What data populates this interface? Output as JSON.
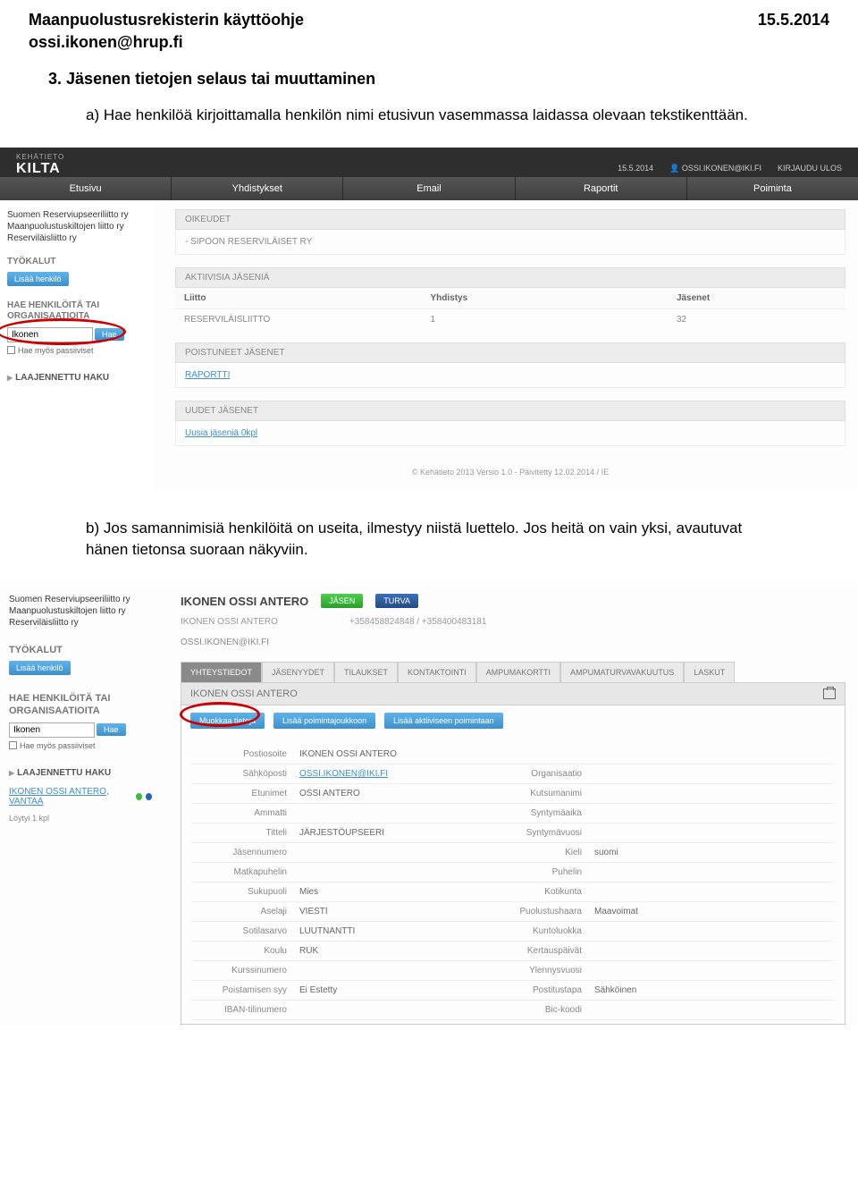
{
  "doc": {
    "title": "Maanpuolustusrekisterin käyttöohje",
    "date": "15.5.2014",
    "email": "ossi.ikonen@hrup.fi",
    "section_num": "3.",
    "section_title": "Jäsenen tietojen selaus tai muuttaminen",
    "step_a_letter": "a)",
    "step_a_text": "Hae henkilöä kirjoittamalla henkilön nimi etusivun vasemmassa laidassa olevaan tekstikenttään.",
    "step_b_letter": "b)",
    "step_b_text": "Jos samannimisiä henkilöitä on useita, ilmestyy niistä luettelo. Jos heitä on vain yksi, avautuvat hänen tietonsa suoraan näkyviin."
  },
  "shot1": {
    "brand_small": "KEHÄTIETO",
    "brand": "KILTA",
    "top_date": "15.5.2014",
    "top_user": "OSSI.IKONEN@IKI.FI",
    "logout": "KIRJAUDU ULOS",
    "menu": [
      "Etusivu",
      "Yhdistykset",
      "Email",
      "Raportit",
      "Poiminta"
    ],
    "orgs": [
      "Suomen Reserviupseeriliitto ry",
      "Maanpuolustuskiltojen liitto ry",
      "Reserviläisliitto ry"
    ],
    "tools": "TYÖKALUT",
    "add_person": "Lisää henkilö",
    "search_h1": "HAE HENKILÖITÄ TAI",
    "search_h2": "ORGANISAATIOITA",
    "search_value": "Ikonen",
    "hae": "Hae",
    "passive": "Hae myös passiiviset",
    "expand": "LAAJENNETTU HAKU",
    "p_rights": "OIKEUDET",
    "rights_item": "- SIPOON RESERVILÄISET RY",
    "p_active": "AKTIIVISIA JÄSENIÄ",
    "th_liitto": "Liitto",
    "th_yhd": "Yhdistys",
    "th_jas": "Jäsenet",
    "row_liitto": "RESERVILÄISLIITTO",
    "row_yhd": "1",
    "row_jas": "32",
    "p_poist": "POISTUNEET JÄSENET",
    "raportti": "RAPORTTI",
    "p_uudet": "UUDET JÄSENET",
    "uusia": "Uusia jäseniä 0kpl",
    "footer": "© Kehätieto 2013 Versio 1.0 - Päivitetty 12.02.2014 / IE"
  },
  "shot2": {
    "orgs": [
      "Suomen Reserviupseeriliitto ry",
      "Maanpuolustuskiltojen liitto ry",
      "Reserviläisliitto ry"
    ],
    "tools": "TYÖKALUT",
    "add_person": "Lisää henkilö",
    "search_h1": "HAE HENKILÖITÄ TAI",
    "search_h2": "ORGANISAATIOITA",
    "search_value": "Ikonen",
    "hae": "Hae",
    "passive": "Hae myös passiiviset",
    "expand": "LAAJENNETTU HAKU",
    "result": "IKONEN OSSI ANTERO, VANTAA",
    "found": "Löytyi 1 kpl",
    "name": "IKONEN OSSI ANTERO",
    "badge1": "JÄSEN",
    "badge2": "TURVA",
    "sub_name": "IKONEN OSSI ANTERO",
    "sub_phones": "+358458824848 / +358400483181",
    "email": "OSSI.IKONEN@IKI.FI",
    "tabs": [
      "YHTEYSTIEDOT",
      "JÄSENYYDET",
      "TILAUKSET",
      "KONTAKTOINTI",
      "AMPUMAKORTTI",
      "AMPUMATURVAVAKUUTUS",
      "LASKUT"
    ],
    "detail_name": "IKONEN OSSI ANTERO",
    "btn1": "Muokkaa tietoja",
    "btn2": "Lisää poimintajoukkoon",
    "btn3": "Lisää aktiiviseen poimintaan",
    "fields": [
      {
        "l": "Postiosoite",
        "v": "IKONEN OSSI ANTERO",
        "l2": "",
        "v2": ""
      },
      {
        "l": "Sähköposti",
        "v": "OSSI.IKONEN@IKI.FI",
        "v_link": true,
        "l2": "Organisaatio",
        "v2": ""
      },
      {
        "l": "Etunimet",
        "v": "OSSI ANTERO",
        "l2": "Kutsumanimi",
        "v2": ""
      },
      {
        "l": "Ammatti",
        "v": "",
        "l2": "Syntymäaika",
        "v2": ""
      },
      {
        "l": "Titteli",
        "v": "JÄRJESTÖUPSEERI",
        "l2": "Syntymävuosi",
        "v2": ""
      },
      {
        "l": "Jäsennumero",
        "v": "",
        "l2": "Kieli",
        "v2": "suomi"
      },
      {
        "l": "Matkapuhelin",
        "v": "",
        "l2": "Puhelin",
        "v2": ""
      },
      {
        "l": "Sukupuoli",
        "v": "Mies",
        "l2": "Kotikunta",
        "v2": ""
      },
      {
        "l": "Aselaji",
        "v": "VIESTI",
        "l2": "Puolustushaara",
        "v2": "Maavoimat"
      },
      {
        "l": "Sotilasarvo",
        "v": "LUUTNANTTI",
        "l2": "Kuntoluokka",
        "v2": ""
      },
      {
        "l": "Koulu",
        "v": "RUK",
        "l2": "Kertauspäivät",
        "v2": ""
      },
      {
        "l": "Kurssinumero",
        "v": "",
        "l2": "Ylennysvuosi",
        "v2": ""
      },
      {
        "l": "Poistamisen syy",
        "v": "Ei Estetty",
        "l2": "Postitustapa",
        "v2": "Sähköinen"
      },
      {
        "l": "IBAN-tilinumero",
        "v": "",
        "l2": "Bic-koodi",
        "v2": ""
      }
    ]
  }
}
